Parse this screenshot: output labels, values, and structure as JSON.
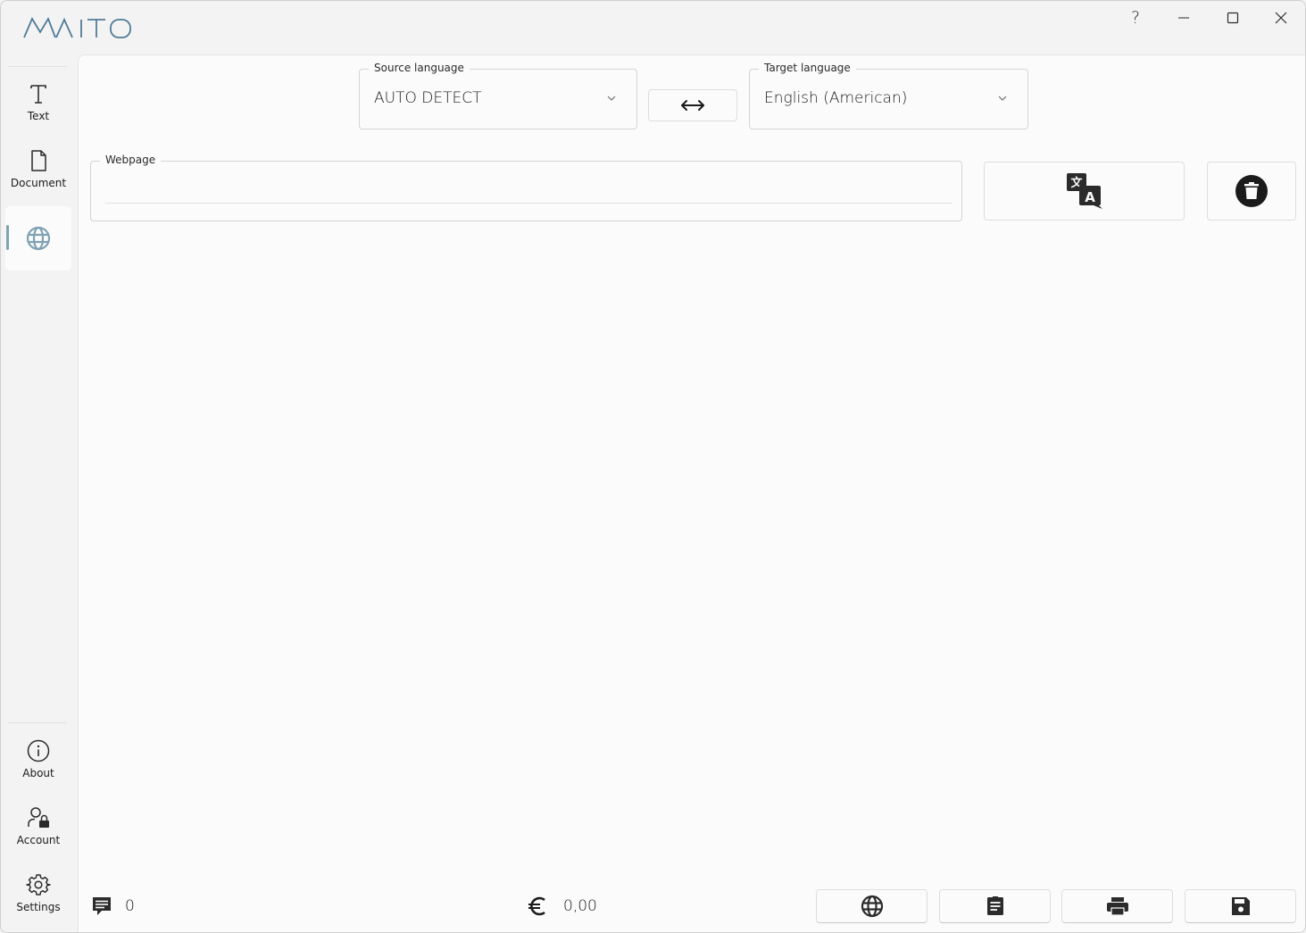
{
  "app": {
    "logo_text": "MAITO"
  },
  "titlebar": {
    "help_label": "?"
  },
  "sidebar": {
    "items": [
      {
        "label": "Text",
        "icon": "text-icon"
      },
      {
        "label": "Document",
        "icon": "document-icon"
      },
      {
        "label": "",
        "icon": "globe-icon",
        "active": true
      }
    ],
    "bottom_items": [
      {
        "label": "About",
        "icon": "info-icon"
      },
      {
        "label": "Account",
        "icon": "account-lock-icon"
      },
      {
        "label": "Settings",
        "icon": "gear-icon"
      }
    ]
  },
  "languages": {
    "source_label": "Source language",
    "source_value": "AUTO DETECT",
    "target_label": "Target language",
    "target_value": "English (American)",
    "swap_icon": "swap-arrows-icon"
  },
  "webpage": {
    "label": "Webpage",
    "value": ""
  },
  "actions": {
    "translate_icon": "translate-icon",
    "clear_icon": "delete-icon"
  },
  "status": {
    "chars_count": "0",
    "cost": "0,00",
    "currency_icon": "euro-icon"
  },
  "bottom_toolbar": [
    "globe-icon",
    "document-icon",
    "print-icon",
    "save-icon"
  ],
  "colors": {
    "accent": "#7fa2b3",
    "logo": "#4f7b96",
    "icon": "#2b2b2b"
  }
}
